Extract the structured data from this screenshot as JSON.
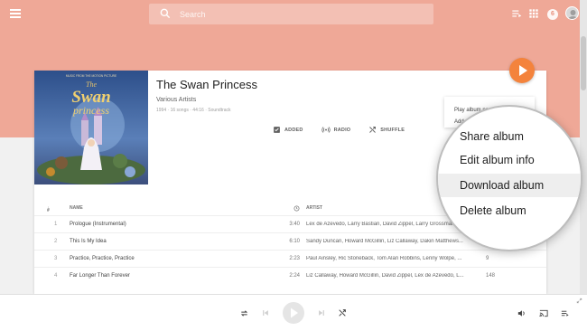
{
  "header": {
    "search_placeholder": "Search",
    "notifications_count": "6"
  },
  "album": {
    "title": "The Swan Princess",
    "artist": "Various Artists",
    "meta": "1994 · 16 songs · 44:16 · Soundtrack",
    "cover_banner_text": "MUSIC FROM THE MOTION PICTURE",
    "cover_title_line1": "The",
    "cover_title_line2": "Swan",
    "cover_title_line3": "princess",
    "actions": {
      "added": "ADDED",
      "radio": "RADIO",
      "shuffle": "SHUFFLE"
    }
  },
  "table": {
    "columns": {
      "number": "#",
      "name": "NAME",
      "artist": "ARTIST"
    },
    "rows": [
      {
        "num": "1",
        "name": "Prologue (Instrumental)",
        "duration": "3:40",
        "artist": "Lex de Azevedo, Larry Bastian, David Zippel, Larry Grossman...",
        "plays": ""
      },
      {
        "num": "2",
        "name": "This Is My Idea",
        "duration": "6:10",
        "artist": "Sandy Duncan, Howard McGillin, Liz Callaway, Dakin Matthews...",
        "plays": ""
      },
      {
        "num": "3",
        "name": "Practice, Practice, Practice",
        "duration": "2:23",
        "artist": "Paul Ainsley, Ric Stoneback, Tom Alan Robbins, Lenny Wolpe, ...",
        "plays": "9"
      },
      {
        "num": "4",
        "name": "Far Longer Than Forever",
        "duration": "2:24",
        "artist": "Liz Callaway, Howard McGillin, David Zippel, Lex de Azevedo, L...",
        "plays": "148"
      }
    ]
  },
  "context_menu": {
    "items": [
      "Play album next",
      "Add album to queue"
    ]
  },
  "magnified_menu": {
    "items": [
      "Share album",
      "Edit album info",
      "Download album",
      "Delete album"
    ],
    "highlighted": "Download album"
  },
  "colors": {
    "accent": "#f4833c",
    "header_band": "#efa897"
  }
}
